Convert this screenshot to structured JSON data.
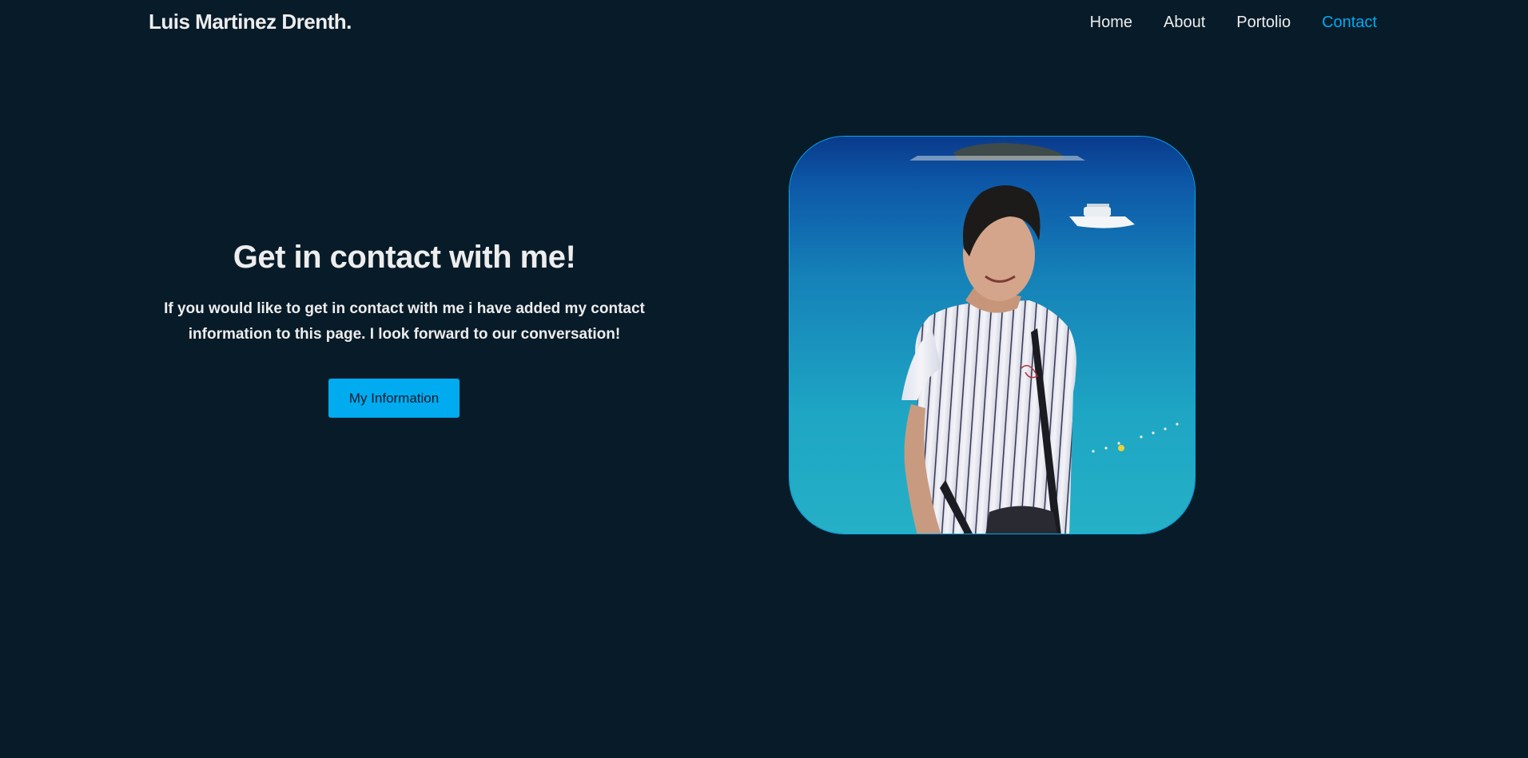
{
  "header": {
    "logo": "Luis Martinez Drenth.",
    "nav": [
      {
        "label": "Home"
      },
      {
        "label": "About"
      },
      {
        "label": "Portolio"
      },
      {
        "label": "Contact"
      }
    ]
  },
  "hero": {
    "title": "Get in contact with me!",
    "description": "If you would like to get in contact with me i have added my contact information to this page. I look forward to our conversation!",
    "button_label": "My Information"
  },
  "colors": {
    "background": "#081b29",
    "accent": "#00abf0",
    "text": "#ededed"
  },
  "photo": {
    "icon": "profile-photo"
  }
}
